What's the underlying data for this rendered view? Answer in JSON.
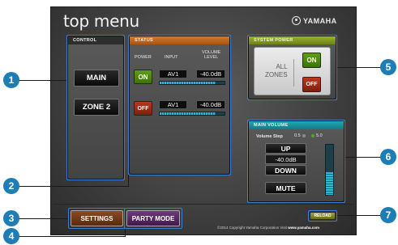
{
  "app": {
    "title": "top menu",
    "brand": "YAMAHA"
  },
  "control": {
    "header": "CONTROL",
    "main_label": "MAIN",
    "zone2_label": "ZONE 2"
  },
  "status": {
    "header": "STATUS",
    "col_power": "POWER",
    "col_input": "INPUT",
    "col_volume": "VOLUME\nLEVEL",
    "rows": [
      {
        "power": "ON",
        "input": "AV1",
        "volume": "-40.0dB",
        "level": 0.86
      },
      {
        "power": "OFF",
        "input": "AV1",
        "volume": "-40.0dB",
        "level": 0.86
      }
    ]
  },
  "system_power": {
    "header": "SYSTEM POWER",
    "zones_label": "ALL\nZONES",
    "on_label": "ON",
    "off_label": "OFF"
  },
  "main_volume": {
    "header": "MAIN VOLUME",
    "step_label": "Volume Step",
    "step_options": [
      "0.5",
      "5.0"
    ],
    "up_label": "UP",
    "value": "-40.0dB",
    "down_label": "DOWN",
    "mute_label": "MUTE",
    "level": 0.45
  },
  "footer": {
    "settings_label": "SETTINGS",
    "party_label": "PARTY MODE",
    "reload_label": "RELOAD",
    "copyright": "©2014 Copyright Yamaha Corporation Visit",
    "link": "www.yamaha.com"
  },
  "callouts": [
    "1",
    "2",
    "3",
    "4",
    "5",
    "6",
    "7"
  ],
  "colors": {
    "callout": "#1e7db5",
    "selection": "#3a7fd0",
    "status_header": "#c46a20",
    "power_header": "#8aa020",
    "volume_header": "#1c97a4",
    "on_button": "#4e8c14",
    "off_button": "#9e2e16"
  }
}
